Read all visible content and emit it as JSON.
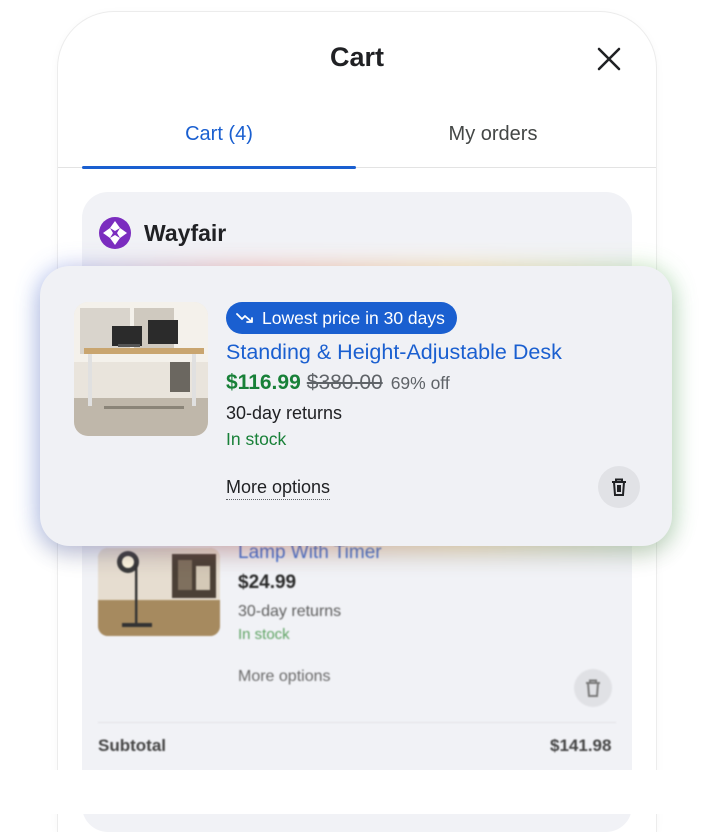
{
  "header": {
    "title": "Cart"
  },
  "tabs": [
    {
      "label": "Cart (4)",
      "active": true
    },
    {
      "label": "My orders",
      "active": false
    }
  ],
  "merchant": {
    "name": "Wayfair",
    "logo_color": "#7b2cbf"
  },
  "items": [
    {
      "badge": "Lowest price in 30 days",
      "title": "Standing & Height-Adjustable Desk",
      "sale_price": "$116.99",
      "original_price": "$380.00",
      "discount": "69% off",
      "returns": "30-day returns",
      "stock": "In stock",
      "more_options": "More options"
    },
    {
      "title": "Lamp With Timer",
      "price": "$24.99",
      "returns": "30-day returns",
      "stock": "In stock",
      "more_options": "More options"
    }
  ],
  "summary": {
    "subtotal_label": "Subtotal",
    "subtotal_value": "$141.98"
  },
  "colors": {
    "accent": "#1a5fd0",
    "price_green": "#188038",
    "card_bg": "#f1f2f6"
  },
  "icons": {
    "close": "close-icon",
    "trash": "trash-icon",
    "trend": "trending-down-icon"
  }
}
